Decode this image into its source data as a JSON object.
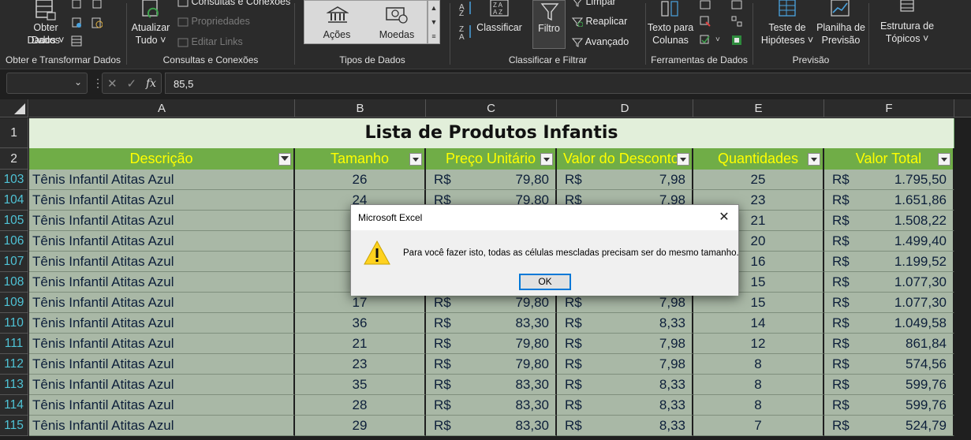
{
  "ribbon": {
    "groups": {
      "obter": {
        "label": "Obter e Transformar Dados",
        "obter_dados": "Obter Dados",
        "obter_dados_sub": "Dados ˅"
      },
      "consultas": {
        "label": "Consultas e Conexões",
        "atualizar": "Atualizar",
        "atualizar_sub": "Tudo ˅",
        "consultas_conexoes": "Consultas e Conexões",
        "propriedades": "Propriedades",
        "editar_links": "Editar Links"
      },
      "tipos": {
        "label": "Tipos de Dados",
        "acoes": "Ações",
        "moedas": "Moedas"
      },
      "classificar": {
        "label": "Classificar e Filtrar",
        "classificar": "Classificar",
        "filtro": "Filtro",
        "limpar": "Limpar",
        "reaplicar": "Reaplicar",
        "avancado": "Avançado"
      },
      "ferramentas": {
        "label": "Ferramentas de Dados",
        "texto_para": "Texto para",
        "colunas": "Colunas"
      },
      "previsao": {
        "label": "Previsão",
        "teste": "Teste de",
        "hipoteses": "Hipóteses ˅",
        "planilha": "Planilha de",
        "previsao_btn": "Previsão"
      },
      "estrutura": {
        "estrutura": "Estrutura de",
        "topicos": "Tópicos ˅"
      }
    }
  },
  "formula_bar": {
    "name_box": "",
    "value": "85,5",
    "fx": "fx"
  },
  "sheet": {
    "columns": [
      "A",
      "B",
      "C",
      "D",
      "E",
      "F"
    ],
    "title_row": "1",
    "header_row": "2",
    "title": "Lista de Produtos Infantis",
    "headers": [
      "Descrição",
      "Tamanho",
      "Preço Unitário",
      "Valor do Desconto",
      "Quantidades",
      "Valor Total"
    ],
    "currency": "R$",
    "rows": [
      {
        "row": "103",
        "desc": "Tênis Infantil Atitas Azul",
        "tam": "26",
        "preco": "79,80",
        "desc_val": "7,98",
        "qtd": "25",
        "total": "1.795,50"
      },
      {
        "row": "104",
        "desc": "Tênis Infantil Atitas Azul",
        "tam": "24",
        "preco": "79,80",
        "desc_val": "7,98",
        "qtd": "23",
        "total": "1.651,86"
      },
      {
        "row": "105",
        "desc": "Tênis Infantil Atitas Azul",
        "tam": "",
        "preco": "",
        "desc_val": "",
        "qtd": "21",
        "total": "1.508,22"
      },
      {
        "row": "106",
        "desc": "Tênis Infantil Atitas Azul",
        "tam": "",
        "preco": "",
        "desc_val": "",
        "qtd": "20",
        "total": "1.499,40"
      },
      {
        "row": "107",
        "desc": "Tênis Infantil Atitas Azul",
        "tam": "",
        "preco": "",
        "desc_val": "",
        "qtd": "16",
        "total": "1.199,52"
      },
      {
        "row": "108",
        "desc": "Tênis Infantil Atitas Azul",
        "tam": "",
        "preco": "",
        "desc_val": "",
        "qtd": "15",
        "total": "1.077,30"
      },
      {
        "row": "109",
        "desc": "Tênis Infantil Atitas Azul",
        "tam": "17",
        "preco": "79,80",
        "desc_val": "7,98",
        "qtd": "15",
        "total": "1.077,30"
      },
      {
        "row": "110",
        "desc": "Tênis Infantil Atitas Azul",
        "tam": "36",
        "preco": "83,30",
        "desc_val": "8,33",
        "qtd": "14",
        "total": "1.049,58"
      },
      {
        "row": "111",
        "desc": "Tênis Infantil Atitas Azul",
        "tam": "21",
        "preco": "79,80",
        "desc_val": "7,98",
        "qtd": "12",
        "total": "861,84"
      },
      {
        "row": "112",
        "desc": "Tênis Infantil Atitas Azul",
        "tam": "23",
        "preco": "79,80",
        "desc_val": "7,98",
        "qtd": "8",
        "total": "574,56"
      },
      {
        "row": "113",
        "desc": "Tênis Infantil Atitas Azul",
        "tam": "35",
        "preco": "83,30",
        "desc_val": "8,33",
        "qtd": "8",
        "total": "599,76"
      },
      {
        "row": "114",
        "desc": "Tênis Infantil Atitas Azul",
        "tam": "28",
        "preco": "83,30",
        "desc_val": "8,33",
        "qtd": "8",
        "total": "599,76"
      },
      {
        "row": "115",
        "desc": "Tênis Infantil Atitas Azul",
        "tam": "29",
        "preco": "83,30",
        "desc_val": "8,33",
        "qtd": "7",
        "total": "524,79"
      }
    ]
  },
  "dialog": {
    "title": "Microsoft Excel",
    "close": "✕",
    "message": "Para você fazer isto, todas as células mescladas precisam ser do mesmo tamanho.",
    "ok": "OK"
  },
  "colors": {
    "title_fill": "#e2efda",
    "header_fill": "#70ad47",
    "header_text": "#ffff00",
    "data_fill": "#a9b8a6",
    "filtered_row_number": "#4fc3d6"
  }
}
